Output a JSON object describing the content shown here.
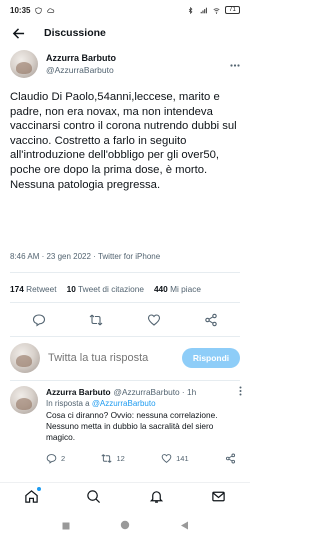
{
  "status": {
    "time": "10:35",
    "battery": "71"
  },
  "topbar": {
    "title": "Discussione"
  },
  "author": {
    "name": "Azzurra Barbuto",
    "handle": "@AzzurraBarbuto"
  },
  "tweet": {
    "text": "Claudio Di Paolo,54anni,leccese, marito e padre, non era novax, ma non intendeva vaccinarsi contro il corona nutrendo dubbi sul vaccino. Costretto a farlo in seguito all'introduzione dell'obbligo per gli over50, poche ore dopo la prima dose, è morto. Nessuna patologia pregressa.",
    "time": "8:46 AM",
    "date": "23 gen 2022",
    "source": "Twitter for iPhone"
  },
  "stats": {
    "retweets_count": "174",
    "retweets_label": "Retweet",
    "quotes_count": "10",
    "quotes_label": "Tweet di citazione",
    "likes_count": "440",
    "likes_label": "Mi piace"
  },
  "reply_box": {
    "placeholder": "Twitta la tua risposta",
    "button": "Rispondi"
  },
  "reply": {
    "name": "Azzurra Barbuto",
    "handle": "@AzzurraBarbuto",
    "age": "1h",
    "replying_prefix": "In risposta a",
    "replying_to": "@AzzurraBarbuto",
    "text": "Cosa ci diranno? Ovvio: nessuna correlazione. Nessuno metta in dubbio la sacralità del siero magico.",
    "replies": "2",
    "retweets": "12",
    "likes": "141"
  },
  "icons": {
    "accent": "#1d9bf0",
    "grey": "#536471"
  }
}
